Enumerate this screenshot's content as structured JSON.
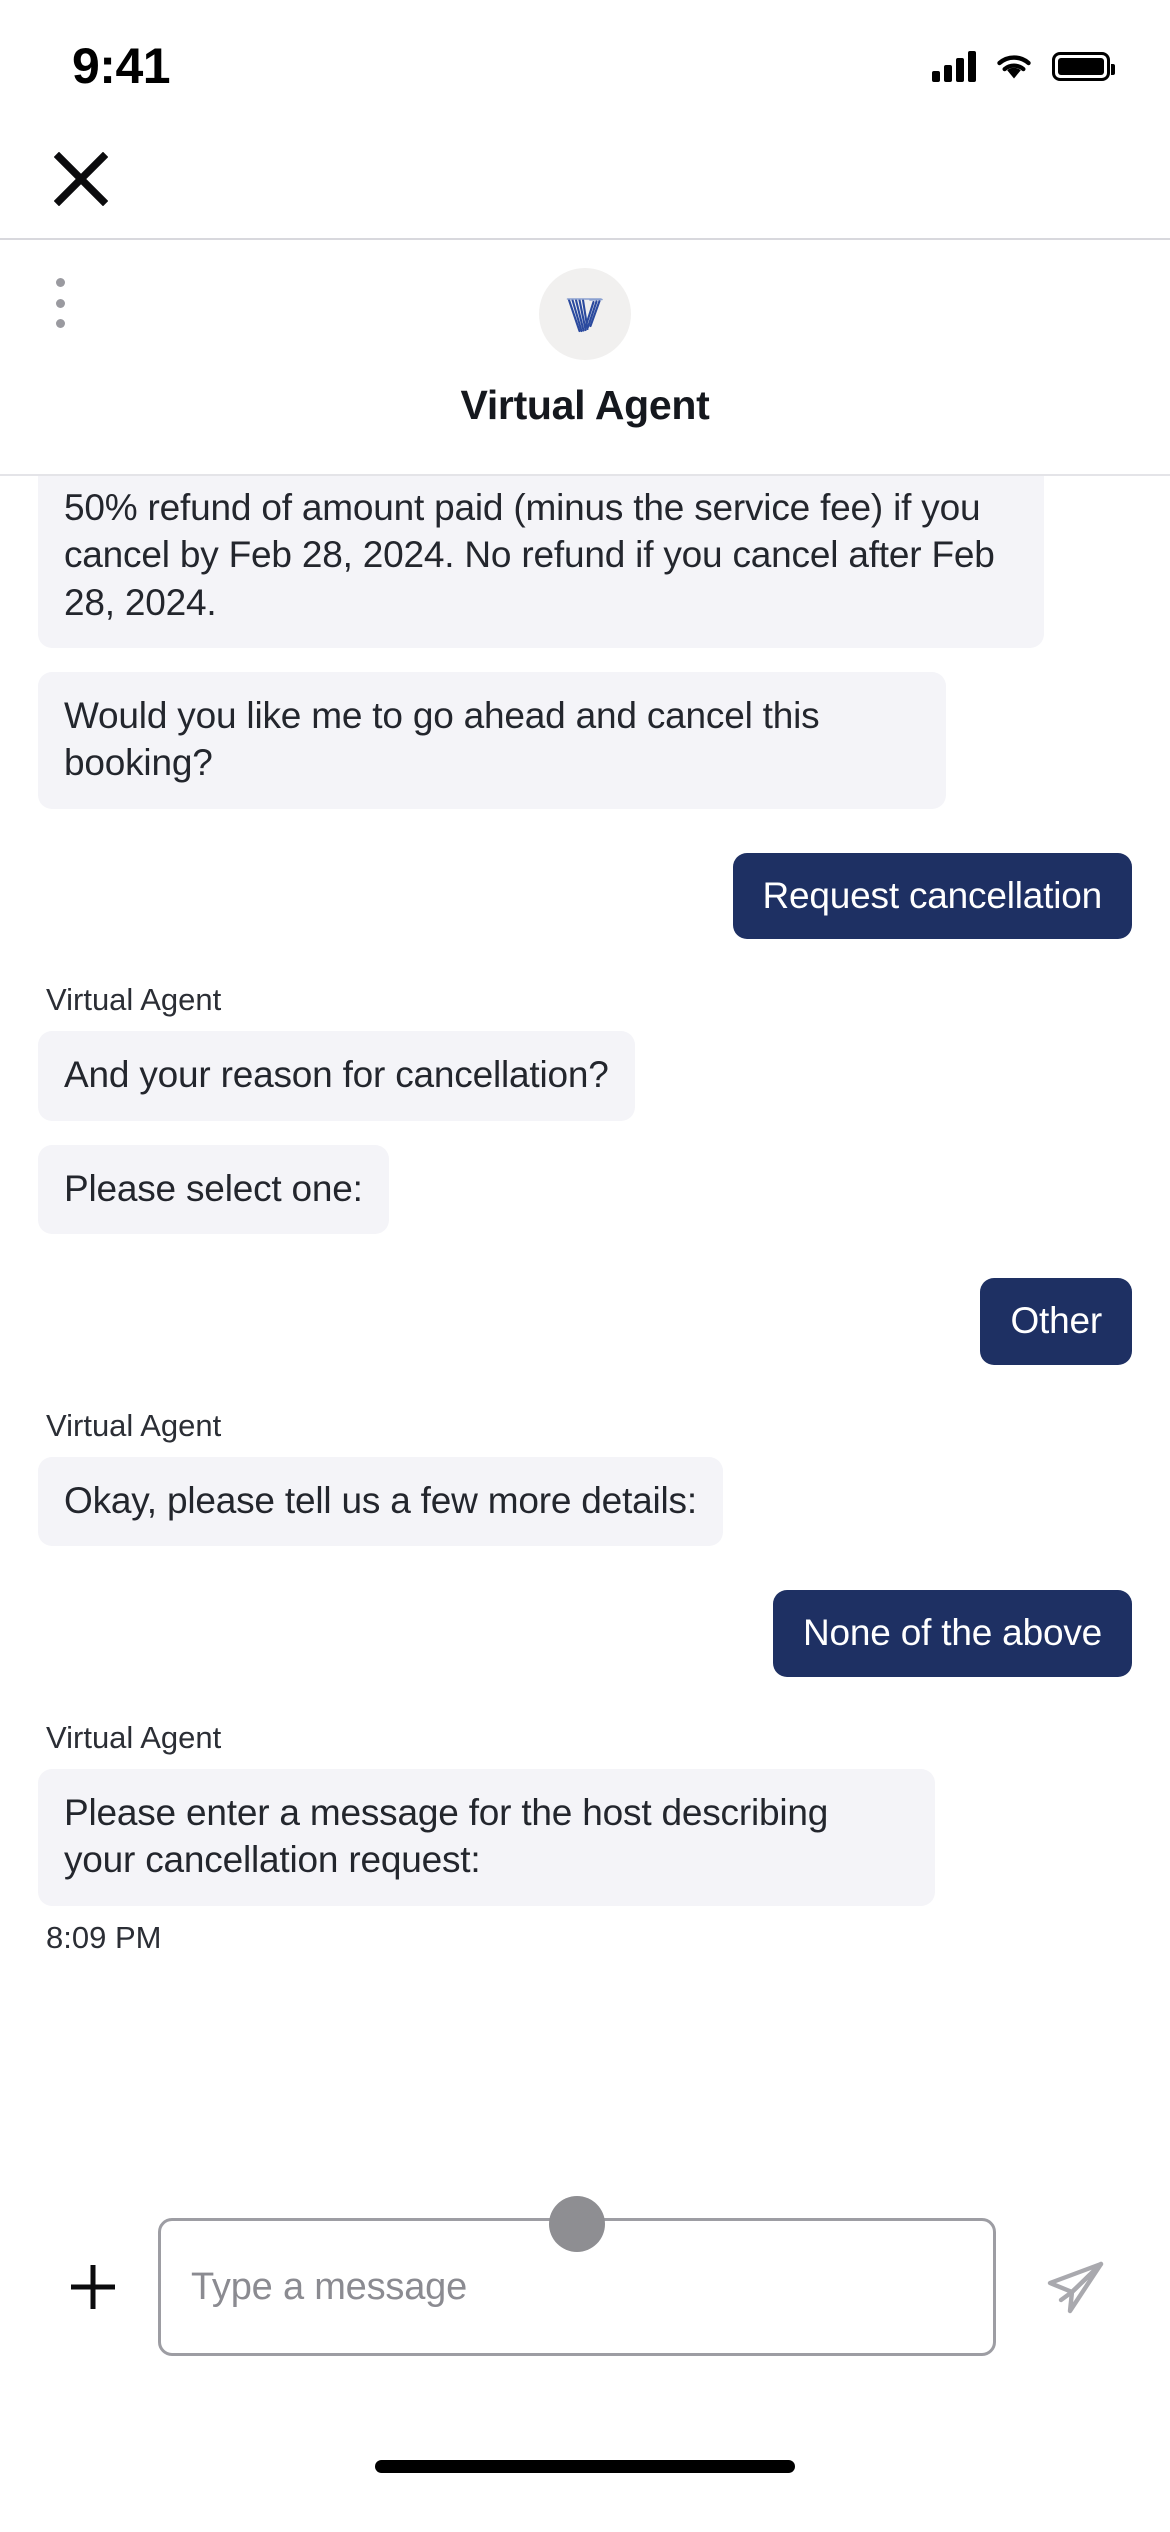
{
  "status_bar": {
    "time": "9:41",
    "signal_icon": "cellular-signal-icon",
    "wifi_icon": "wifi-icon",
    "battery_icon": "battery-icon"
  },
  "top_bar": {
    "close_label": "close-icon"
  },
  "header": {
    "menu_icon": "kebab-menu-icon",
    "avatar_icon": "virtual-agent-avatar",
    "title": "Virtual Agent",
    "avatar_bg": "#f1f0ef",
    "logo_color": "#2b4a9e"
  },
  "colors": {
    "bubble_bg": "#f4f4f8",
    "bubble_text": "#23262d",
    "reply_bg": "#1e3063",
    "reply_text": "#ffffff",
    "divider": "#e4e4e8"
  },
  "conversation": [
    {
      "type": "agent_bubble",
      "clipped": true,
      "text": "50% refund of amount paid (minus the service fee) if you cancel by Feb 28, 2024. No refund if you cancel after Feb 28, 2024."
    },
    {
      "type": "agent_bubble",
      "text": "Would you like me to go ahead and cancel this booking?"
    },
    {
      "type": "user_reply",
      "text": "Request cancellation"
    },
    {
      "type": "sender_label",
      "text": "Virtual Agent"
    },
    {
      "type": "agent_bubble",
      "text": "And your reason for cancellation?"
    },
    {
      "type": "agent_bubble",
      "text": "Please select one:"
    },
    {
      "type": "user_reply",
      "text": "Other"
    },
    {
      "type": "sender_label",
      "text": "Virtual Agent"
    },
    {
      "type": "agent_bubble",
      "text": "Okay, please tell us a few more details:"
    },
    {
      "type": "user_reply",
      "text": "None of the above"
    },
    {
      "type": "sender_label",
      "text": "Virtual Agent"
    },
    {
      "type": "agent_bubble",
      "text": "Please enter a message for the host describing your cancellation request:"
    },
    {
      "type": "timestamp",
      "text": "8:09 PM"
    }
  ],
  "messages": {
    "m0": "50% refund of amount paid (minus the service fee) if you cancel by Feb 28, 2024. No refund if you cancel after Feb 28, 2024.",
    "m1": "Would you like me to go ahead and cancel this booking?",
    "m2": "Request cancellation",
    "m3": "Virtual Agent",
    "m4": "And your reason for cancellation?",
    "m5": "Please select one:",
    "m6": "Other",
    "m7": "Virtual Agent",
    "m8": "Okay, please tell us a few more details:",
    "m9": "None of the above",
    "m10": "Virtual Agent",
    "m11": "Please enter a message for the host describing your cancellation request:",
    "m12": "8:09 PM"
  },
  "composer": {
    "add_icon": "plus-icon",
    "input_value": "",
    "input_placeholder": "Type a message",
    "send_icon": "send-paper-plane-icon",
    "cursor_indicator": "touch-pointer-dot"
  },
  "home_indicator": "home-indicator-bar"
}
